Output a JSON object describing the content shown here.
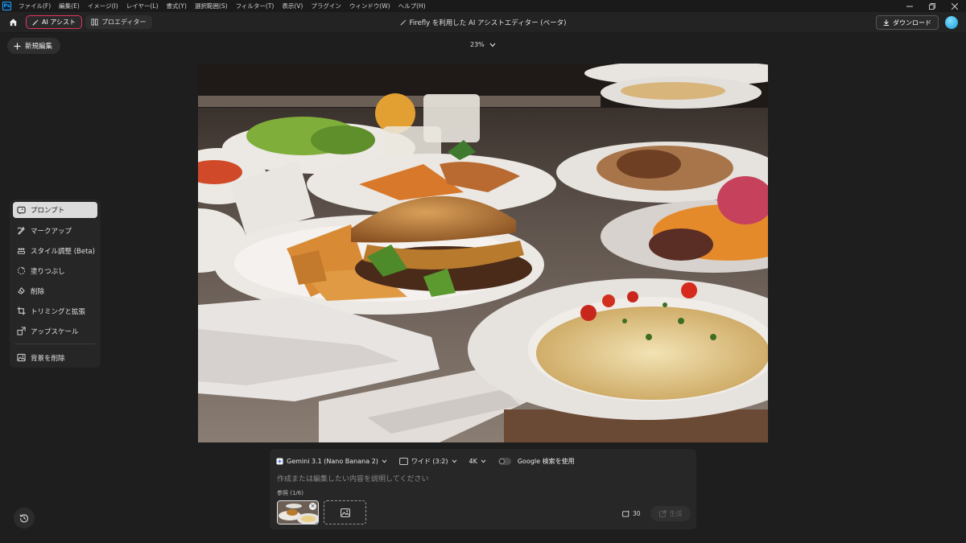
{
  "menubar": {
    "logo": "Ps",
    "items": [
      "ファイル(F)",
      "編集(E)",
      "イメージ(I)",
      "レイヤー(L)",
      "書式(Y)",
      "選択範囲(S)",
      "フィルター(T)",
      "表示(V)",
      "プラグイン",
      "ウィンドウ(W)",
      "ヘルプ(H)"
    ]
  },
  "toolbar": {
    "ai_assist_label": "AI アシスト",
    "pro_editor_label": "プロエディター",
    "title": "Firefly を利用した AI アシストエディター (ベータ)",
    "download_label": "ダウンロード"
  },
  "new_edit_label": "新規編集",
  "zoom_level": "23%",
  "tools": [
    {
      "label": "プロンプト",
      "icon": "prompt-icon"
    },
    {
      "label": "マークアップ",
      "icon": "markup-icon"
    },
    {
      "label": "スタイル調整 (Beta)",
      "icon": "style-icon"
    },
    {
      "label": "塗りつぶし",
      "icon": "fill-icon"
    },
    {
      "label": "削除",
      "icon": "remove-icon"
    },
    {
      "label": "トリミングと拡張",
      "icon": "crop-icon"
    },
    {
      "label": "アップスケール",
      "icon": "upscale-icon"
    },
    {
      "label": "背景を削除",
      "icon": "remove-background-icon"
    }
  ],
  "prompt_panel": {
    "model_label": "Gemini 3.1 (Nano Banana 2)",
    "aspect_label": "ワイド (3:2)",
    "resolution_label": "4K",
    "google_search_label": "Google 検索を使用",
    "google_search_enabled": false,
    "placeholder": "作成または編集したい内容を説明してください",
    "reference_label": "参照 (1/6)",
    "credits": "30",
    "generate_label": "生成"
  },
  "colors": {
    "background": "#1e1e1e",
    "ai_assist_border": "#e2345f",
    "avatar": "#1a9ad6"
  }
}
